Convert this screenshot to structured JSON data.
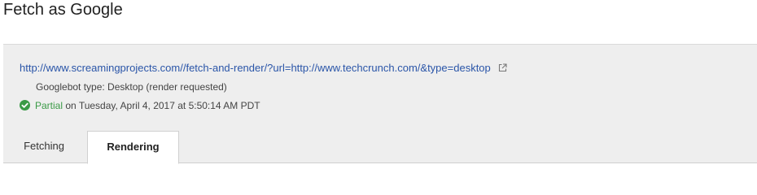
{
  "header": {
    "title": "Fetch as Google"
  },
  "fetch": {
    "url": "http://www.screamingprojects.com//fetch-and-render/?url=http://www.techcrunch.com/&type=desktop",
    "bot_type": "Googlebot type: Desktop (render requested)",
    "status_word": "Partial",
    "status_detail": " on Tuesday, April 4, 2017 at 5:50:14 AM PDT",
    "status_color": "#3a9a46",
    "link_color": "#2a55a8",
    "icons": {
      "status": "check-circle-icon",
      "url": "external-link-icon"
    }
  },
  "tabs": [
    {
      "label": "Fetching",
      "active": false
    },
    {
      "label": "Rendering",
      "active": true
    }
  ]
}
